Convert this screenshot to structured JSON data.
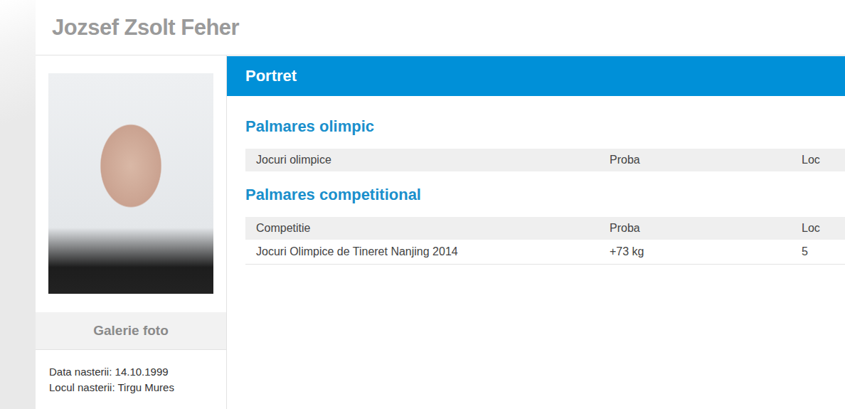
{
  "header": {
    "name": "Jozsef Zsolt Feher"
  },
  "profile": {
    "gallery_label": "Galerie foto",
    "birth_date": "Data nasterii: 14.10.1999",
    "birth_place": "Locul nasterii: Tirgu Mures"
  },
  "portrait_bar": {
    "title": "Portret"
  },
  "sections": [
    {
      "title": "Palmares olimpic",
      "columns": [
        "Jocuri olimpice",
        "Proba",
        "Loc"
      ],
      "rows": []
    },
    {
      "title": "Palmares competitional",
      "columns": [
        "Competitie",
        "Proba",
        "Loc"
      ],
      "rows": [
        [
          "Jocuri Olimpice de Tineret Nanjing 2014",
          "+73 kg",
          "5"
        ]
      ]
    }
  ]
}
